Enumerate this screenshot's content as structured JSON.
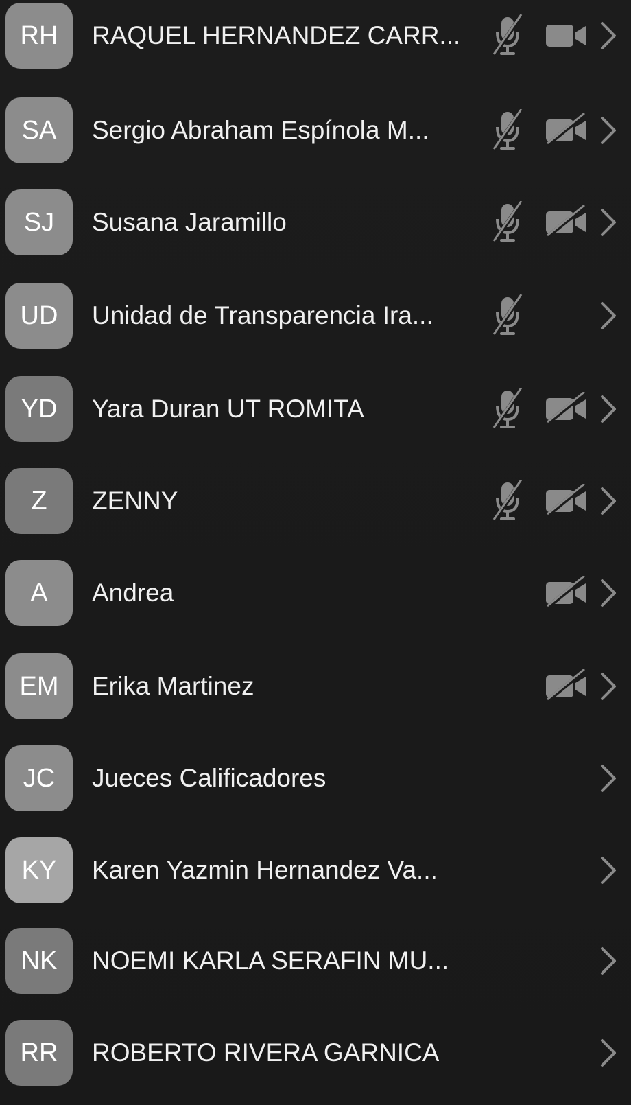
{
  "participants": [
    {
      "initials": "RH",
      "name": "RAQUEL HERNANDEZ CARR...",
      "mic": "mic-muted-icon",
      "cam": "video-on-icon",
      "avatar_tone": "mid"
    },
    {
      "initials": "SA",
      "name": "Sergio Abraham Espínola M...",
      "mic": "mic-muted-icon",
      "cam": "video-off-icon",
      "avatar_tone": "mid"
    },
    {
      "initials": "SJ",
      "name": "Susana Jaramillo",
      "mic": "mic-muted-icon",
      "cam": "video-off-icon",
      "avatar_tone": "mid"
    },
    {
      "initials": "UD",
      "name": "Unidad de Transparencia Ira...",
      "mic": "mic-muted-icon",
      "cam": "",
      "avatar_tone": "mid"
    },
    {
      "initials": "YD",
      "name": "Yara Duran UT ROMITA",
      "mic": "mic-muted-icon",
      "cam": "video-off-icon",
      "avatar_tone": "dark"
    },
    {
      "initials": "Z",
      "name": "ZENNY",
      "mic": "mic-muted-icon",
      "cam": "video-off-icon",
      "avatar_tone": "dark"
    },
    {
      "initials": "A",
      "name": "Andrea",
      "mic": "",
      "cam": "video-off-icon",
      "avatar_tone": "mid"
    },
    {
      "initials": "EM",
      "name": "Erika Martinez",
      "mic": "",
      "cam": "video-off-icon",
      "avatar_tone": "mid"
    },
    {
      "initials": "JC",
      "name": "Jueces Calificadores",
      "mic": "",
      "cam": "",
      "avatar_tone": "mid"
    },
    {
      "initials": "KY",
      "name": "Karen Yazmin Hernandez Va...",
      "mic": "",
      "cam": "",
      "avatar_tone": "light"
    },
    {
      "initials": "NK",
      "name": "NOEMI KARLA SERAFIN MU...",
      "mic": "",
      "cam": "",
      "avatar_tone": "dark"
    },
    {
      "initials": "RR",
      "name": "ROBERTO RIVERA GARNICA",
      "mic": "",
      "cam": "",
      "avatar_tone": "dark"
    }
  ],
  "colors": {
    "background": "#1a1a1a",
    "avatar": "#8c8c8c",
    "icon": "#8a8a8a",
    "text": "#f0f0f0"
  }
}
